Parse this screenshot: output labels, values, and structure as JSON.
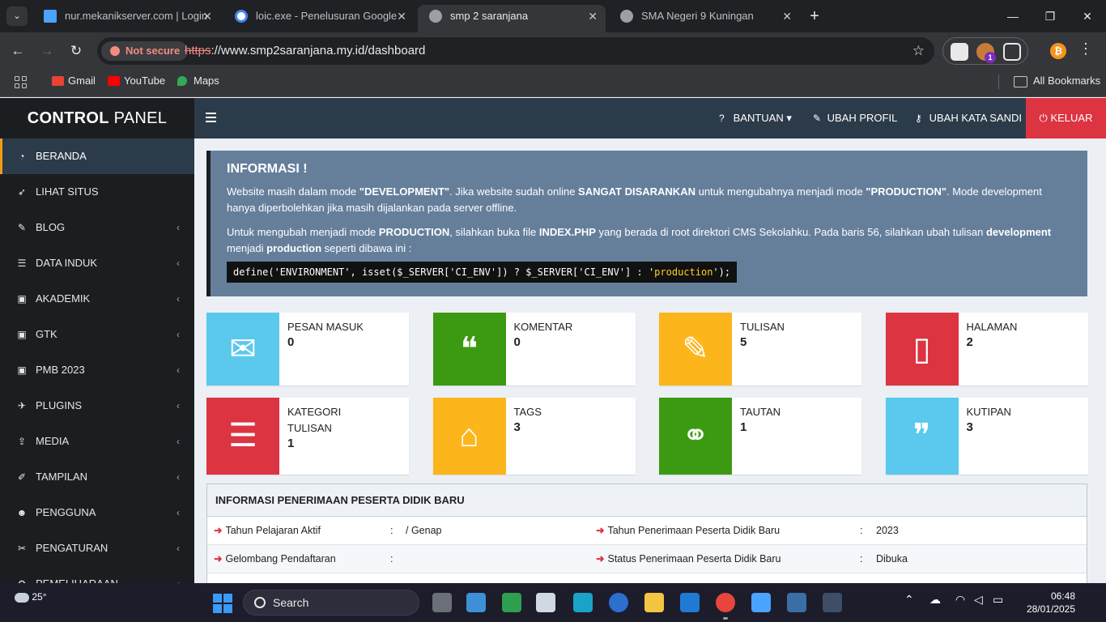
{
  "browser": {
    "tabs": [
      {
        "title": "nur.mekanikserver.com | Login",
        "active": false
      },
      {
        "title": "loic.exe - Penelusuran Google",
        "active": false
      },
      {
        "title": "smp 2 saranjana",
        "active": true
      },
      {
        "title": "SMA Negeri 9 Kuningan",
        "active": false
      }
    ],
    "security_label": "Not secure",
    "url_protocol": "https",
    "url_rest": "://www.smp2saranjana.my.id/dashboard",
    "extension_badge": "1",
    "bookmarks": [
      "Gmail",
      "YouTube",
      "Maps"
    ],
    "all_bookmarks": "All Bookmarks"
  },
  "sidebar": {
    "brand_bold": "CONTROL",
    "brand_light": "PANEL",
    "items": [
      {
        "label": "BERANDA",
        "icon": "dashboard-icon",
        "glyph": "◔",
        "active": true,
        "submenu": false
      },
      {
        "label": "LIHAT SITUS",
        "icon": "rocket-icon",
        "glyph": "➶",
        "active": false,
        "submenu": false
      },
      {
        "label": "BLOG",
        "icon": "edit-icon",
        "glyph": "✎",
        "active": false,
        "submenu": true
      },
      {
        "label": "DATA INDUK",
        "icon": "list-icon",
        "glyph": "☰",
        "active": false,
        "submenu": true
      },
      {
        "label": "AKADEMIK",
        "icon": "user-card-icon",
        "glyph": "▣",
        "active": false,
        "submenu": true
      },
      {
        "label": "GTK",
        "icon": "user-card-icon",
        "glyph": "▣",
        "active": false,
        "submenu": true
      },
      {
        "label": "PMB 2023",
        "icon": "user-card-icon",
        "glyph": "▣",
        "active": false,
        "submenu": true
      },
      {
        "label": "PLUGINS",
        "icon": "plug-icon",
        "glyph": "✈",
        "active": false,
        "submenu": true
      },
      {
        "label": "MEDIA",
        "icon": "upload-icon",
        "glyph": "⇪",
        "active": false,
        "submenu": true
      },
      {
        "label": "TAMPILAN",
        "icon": "brush-icon",
        "glyph": "✐",
        "active": false,
        "submenu": true
      },
      {
        "label": "PENGGUNA",
        "icon": "users-icon",
        "glyph": "☻",
        "active": false,
        "submenu": true
      },
      {
        "label": "PENGATURAN",
        "icon": "wrench-icon",
        "glyph": "✂",
        "active": false,
        "submenu": true
      },
      {
        "label": "PEMELIHARAAN",
        "icon": "gear-icon",
        "glyph": "⚙",
        "active": false,
        "submenu": true
      }
    ]
  },
  "topnav": {
    "help": "BANTUAN",
    "edit_profile": "UBAH PROFIL",
    "change_password": "UBAH KATA SANDI",
    "logout": "KELUAR"
  },
  "info": {
    "title": "INFORMASI !",
    "p1_a": "Website masih dalam mode ",
    "p1_b": "\"DEVELOPMENT\"",
    "p1_c": ". Jika website sudah online ",
    "p1_d": "SANGAT DISARANKAN",
    "p1_e": " untuk mengubahnya menjadi mode ",
    "p1_f": "\"PRODUCTION\"",
    "p1_g": ". Mode development hanya diperbolehkan jika masih dijalankan pada server offline.",
    "p2_a": "Untuk mengubah menjadi mode ",
    "p2_b": "PRODUCTION",
    "p2_c": ", silahkan buka file ",
    "p2_d": "INDEX.PHP",
    "p2_e": " yang berada di root direktori CMS Sekolahku. Pada baris 56, silahkan ubah tulisan ",
    "p2_f": "development",
    "p2_g": " menjadi ",
    "p2_h": "production",
    "p2_i": " seperti dibawa ini :",
    "code_a": "define('ENVIRONMENT', isset($_SERVER['CI_ENV']) ? $_SERVER['CI_ENV'] : '",
    "code_b": "production",
    "code_c": "');"
  },
  "stats": [
    {
      "label": "PESAN MASUK",
      "value": "0",
      "color": "#5bc8ee",
      "icon": "envelope-icon"
    },
    {
      "label": "KOMENTAR",
      "value": "0",
      "color": "#3c9a12",
      "icon": "comments-icon"
    },
    {
      "label": "TULISAN",
      "value": "5",
      "color": "#fdb51c",
      "icon": "edit-icon"
    },
    {
      "label": "HALAMAN",
      "value": "2",
      "color": "#dd3442",
      "icon": "file-icon"
    },
    {
      "label": "KATEGORI TULISAN",
      "value": "1",
      "color": "#dd3442",
      "icon": "list-icon"
    },
    {
      "label": "TAGS",
      "value": "3",
      "color": "#fdb51c",
      "icon": "tags-icon"
    },
    {
      "label": "TAUTAN",
      "value": "1",
      "color": "#3c9a12",
      "icon": "link-icon"
    },
    {
      "label": "KUTIPAN",
      "value": "3",
      "color": "#5bc8ee",
      "icon": "quote-icon"
    }
  ],
  "ppdb": {
    "title": "INFORMASI PENERIMAAN PESERTA DIDIK BARU",
    "rows": [
      {
        "l_label": "Tahun Pelajaran Aktif",
        "l_value": "/ Genap",
        "r_label": "Tahun Penerimaan Peserta Didik Baru",
        "r_value": "2023"
      },
      {
        "l_label": "Gelombang Pendaftaran",
        "l_value": "",
        "r_label": "Status Penerimaan Peserta Didik Baru",
        "r_value": "Dibuka"
      }
    ],
    "colon": ":"
  },
  "taskbar": {
    "temperature": "25°",
    "search": "Search",
    "time": "06:48",
    "date": "28/01/2025"
  }
}
